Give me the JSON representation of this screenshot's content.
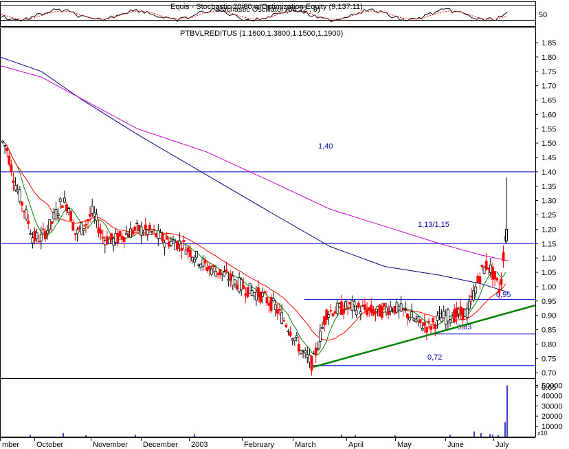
{
  "chart_data": {
    "type": "candlestick",
    "panels": {
      "stochastic": {
        "title": "Equis - Stochastic 20/80 w/Optimization Equity (9,137.11)",
        "subtitle": "Stochastic Oscillator (86.22 , 9)",
        "ytick": "50"
      },
      "price": {
        "title": "PTBVLREDITUS (1.1600,1.3800,1.1500,1.1900)",
        "yticks": [
          "1.85",
          "1.80",
          "1.75",
          "1.70",
          "1.65",
          "1.60",
          "1.55",
          "1.50",
          "1.45",
          "1.40",
          "1.35",
          "1.30",
          "1.25",
          "1.20",
          "1.15",
          "1.10",
          "1.05",
          "1.00",
          "0.95",
          "0.90",
          "0.85",
          "0.80",
          "0.75",
          "0.70",
          "0.65"
        ],
        "ylim": [
          0.65,
          1.85
        ],
        "levels": [
          {
            "label": "1,40",
            "value": 1.4
          },
          {
            "label": "1,13/1,15",
            "value": 1.15
          },
          {
            "label": "0,95",
            "value": 0.955
          },
          {
            "label": "0,83",
            "value": 0.835
          },
          {
            "label": "0,72",
            "value": 0.725
          }
        ],
        "trendline": {
          "from": [
            "March",
            0.72
          ],
          "to": [
            "July",
            0.93
          ]
        },
        "series": [
          {
            "name": "",
            "color": "#008000"
          },
          {
            "name": "",
            "color": "#ff0000"
          },
          {
            "name": "",
            "color": "#000080"
          },
          {
            "name": "",
            "color": "#cc00cc"
          }
        ]
      },
      "volume": {
        "yticks": [
          "50000",
          "40000",
          "30000",
          "20000",
          "10000"
        ],
        "ylim": [
          0,
          55000
        ],
        "unit": "x10",
        "spike": 50000
      }
    },
    "x_labels": [
      "mber",
      "October",
      "November",
      "December",
      "2003",
      "February",
      "March",
      "April",
      "May",
      "June",
      "July"
    ],
    "colors": {
      "up": "#000000",
      "down": "#ff0000",
      "level": "#0000cc",
      "trend": "#008000"
    }
  }
}
